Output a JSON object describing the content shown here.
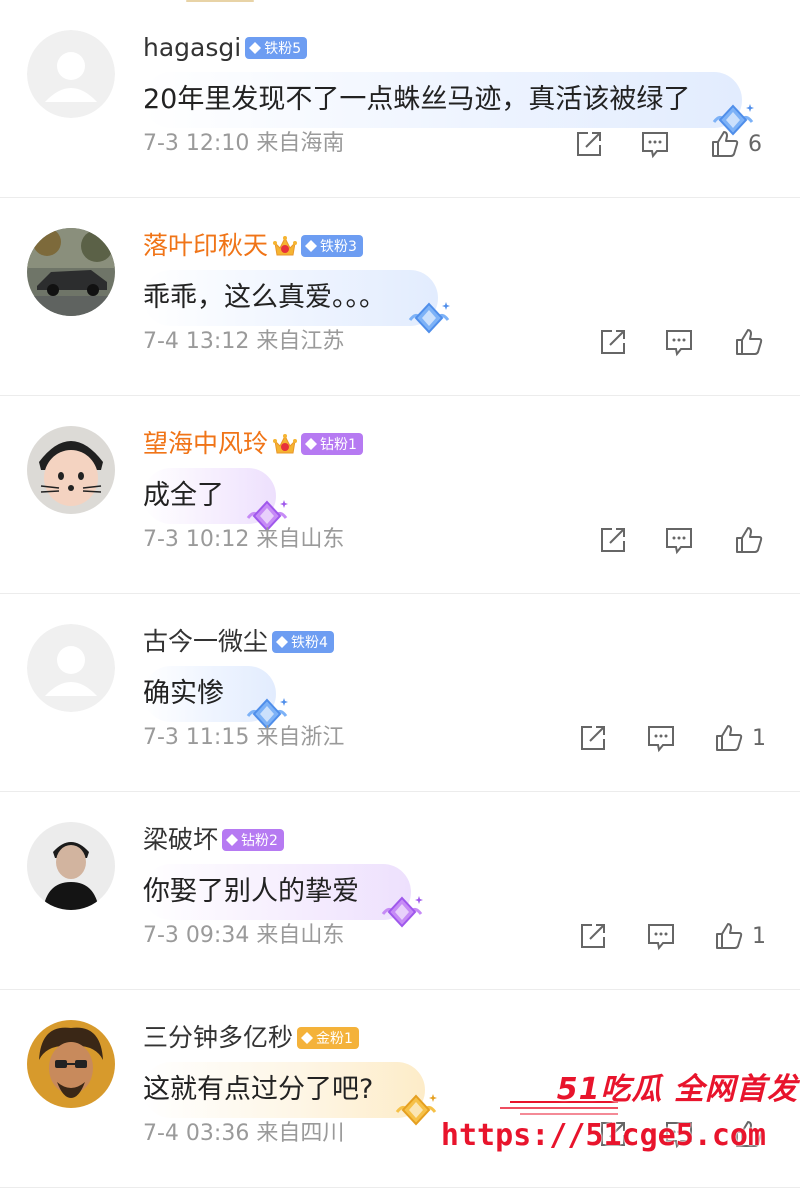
{
  "comments": [
    {
      "username": "hagasgi",
      "name_color": "gray",
      "crown": false,
      "badge": {
        "label": "铁粉5",
        "kind": "iron"
      },
      "text": "20年里发现不了一点蛛丝马迹，真活该被绿了",
      "bubble": "blue",
      "avatar": "default",
      "time": "7-3 12:10",
      "location": "来自海南",
      "like_count": "6"
    },
    {
      "username": "落叶印秋天",
      "name_color": "orange",
      "crown": true,
      "badge": {
        "label": "铁粉3",
        "kind": "iron"
      },
      "text": "乖乖，这么真爱。。。",
      "bubble": "blue",
      "avatar": "car",
      "time": "7-4 13:12",
      "location": "来自江苏",
      "like_count": ""
    },
    {
      "username": "望海中风玲",
      "name_color": "orange",
      "crown": true,
      "badge": {
        "label": "钻粉1",
        "kind": "drill"
      },
      "text": "成全了",
      "bubble": "purple",
      "avatar": "kid",
      "time": "7-3 10:12",
      "location": "来自山东",
      "like_count": ""
    },
    {
      "username": "古今一微尘",
      "name_color": "gray",
      "crown": false,
      "badge": {
        "label": "铁粉4",
        "kind": "iron"
      },
      "text": "确实惨",
      "bubble": "blue",
      "avatar": "default",
      "time": "7-3 11:15",
      "location": "来自浙江",
      "like_count": "1"
    },
    {
      "username": "梁破坏",
      "name_color": "gray",
      "crown": false,
      "badge": {
        "label": "钻粉2",
        "kind": "drill"
      },
      "text": "你娶了别人的挚爱",
      "bubble": "purple",
      "avatar": "man",
      "time": "7-3 09:34",
      "location": "来自山东",
      "like_count": "1"
    },
    {
      "username": "三分钟多亿秒",
      "name_color": "gray",
      "crown": false,
      "badge": {
        "label": "金粉1",
        "kind": "gold"
      },
      "text": "这就有点过分了吧?",
      "bubble": "gold",
      "avatar": "art",
      "time": "7-4 03:36",
      "location": "来自四川",
      "like_count": ""
    }
  ],
  "icons": {
    "repost": "share-square-icon",
    "comment": "comment-icon",
    "like": "thumbs-up-icon"
  },
  "watermark": {
    "line1": "51吃瓜 全网首发",
    "line2": "https://51cge5.com"
  },
  "colors": {
    "orange_name": "#f07417",
    "iron_badge": "#6d9df2",
    "drill_badge": "#b67af2",
    "gold_badge": "#f4b23a",
    "watermark": "#e8142c"
  }
}
